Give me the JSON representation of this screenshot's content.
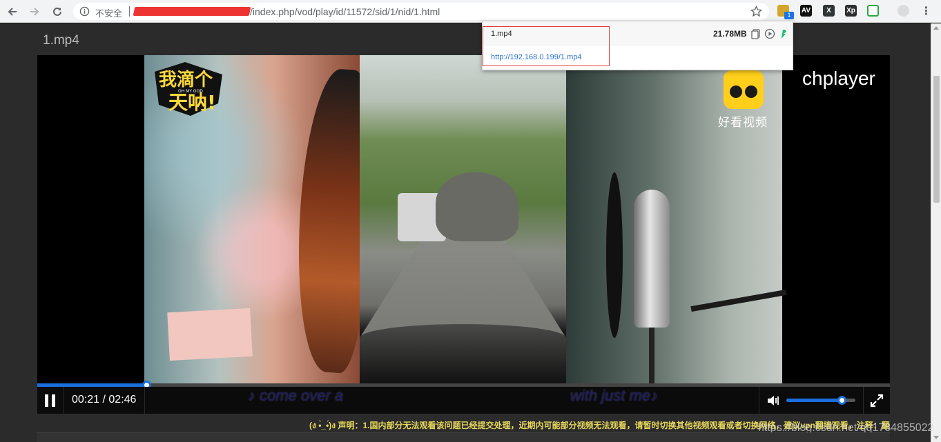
{
  "browser": {
    "security_label": "不安全",
    "url_path": "/index.php/vod/play/id/11572/sid/1/nid/1.html",
    "extension_badge": "1",
    "extensions": [
      {
        "name": "video-download-icon",
        "color": "#d3a52b"
      },
      {
        "name": "av-extension-icon",
        "label": "AV",
        "color": "#111111"
      },
      {
        "name": "x-extension-icon",
        "label": "X",
        "color": "#2f3437"
      },
      {
        "name": "xp-extension-icon",
        "label": "Xp",
        "color": "#2e2e2e"
      },
      {
        "name": "tv-extension-icon",
        "color": "#29a745"
      }
    ]
  },
  "page": {
    "title": "1.mp4"
  },
  "player": {
    "brand": "chplayer",
    "watermark_haokan": "好看视频",
    "watermark_ohmy_main": "我滴个",
    "watermark_ohmy_sub": "天呐!",
    "watermark_ohmy_small": "OH MY GOD",
    "current_time": "00:21",
    "duration": "02:46",
    "time_separator": " / ",
    "progress_fraction": 0.128,
    "volume_fraction": 0.8,
    "subtitle_left": "♪ come over a",
    "subtitle_right": "with just me♪",
    "accent_color": "#1b6fdc"
  },
  "notice": "(ง •̀_•́)ง 声明：1.国内部分无法观看该问题已经提交处理，近期内可能部分视频无法观看，请暂时切换其他视频观看或者切换网络，建议vpn翻墙观看，注释：翻",
  "footer_watermark": "https://blog.csdn.net/qq1784855022",
  "next_section": "",
  "download_popup": {
    "filename": "1.mp4",
    "size": "21.78MB",
    "url": "http://192.168.0.199/1.mp4"
  }
}
